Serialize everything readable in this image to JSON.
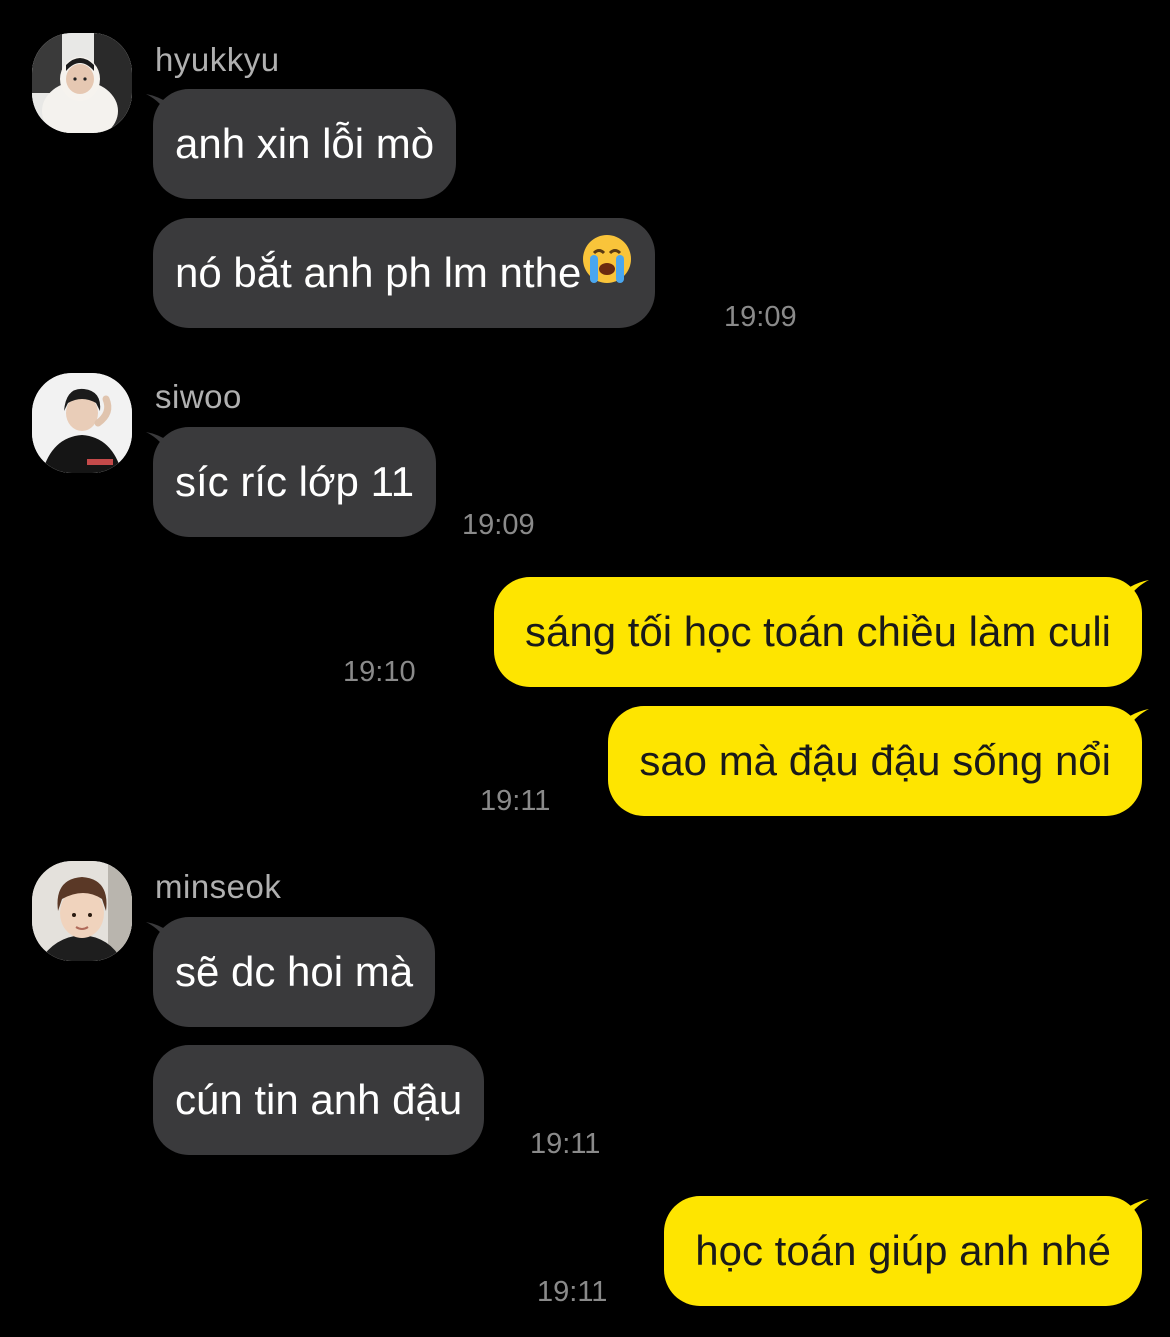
{
  "colors": {
    "background": "#000000",
    "incoming_bubble": "#3a3a3c",
    "outgoing_bubble": "#fee500",
    "timestamp": "#8a8a8a",
    "sender_name": "#b0b0b0"
  },
  "messages": [
    {
      "sender": "hyukkyu",
      "avatar": "hyukkyu-avatar",
      "bubbles": [
        {
          "text": "anh xin lỗi mò"
        },
        {
          "text": "nó bắt anh ph lm nthe",
          "emoji": "loudly-crying-face-icon"
        }
      ],
      "time": "19:09"
    },
    {
      "sender": "siwoo",
      "avatar": "siwoo-avatar",
      "bubbles": [
        {
          "text": "síc ríc lớp 11"
        }
      ],
      "time": "19:09"
    },
    {
      "sender": "me",
      "outgoing": true,
      "bubbles": [
        {
          "text": "sáng tối học toán chiều làm culi",
          "time": "19:10"
        },
        {
          "text": "sao mà đậu đậu sống nổi",
          "time": "19:11"
        }
      ]
    },
    {
      "sender": "minseok",
      "avatar": "minseok-avatar",
      "bubbles": [
        {
          "text": "sẽ dc hoi mà"
        },
        {
          "text": "cún tin anh đậu"
        }
      ],
      "time": "19:11"
    },
    {
      "sender": "me",
      "outgoing": true,
      "bubbles": [
        {
          "text": "học toán giúp anh nhé",
          "time": "19:11"
        }
      ]
    }
  ]
}
